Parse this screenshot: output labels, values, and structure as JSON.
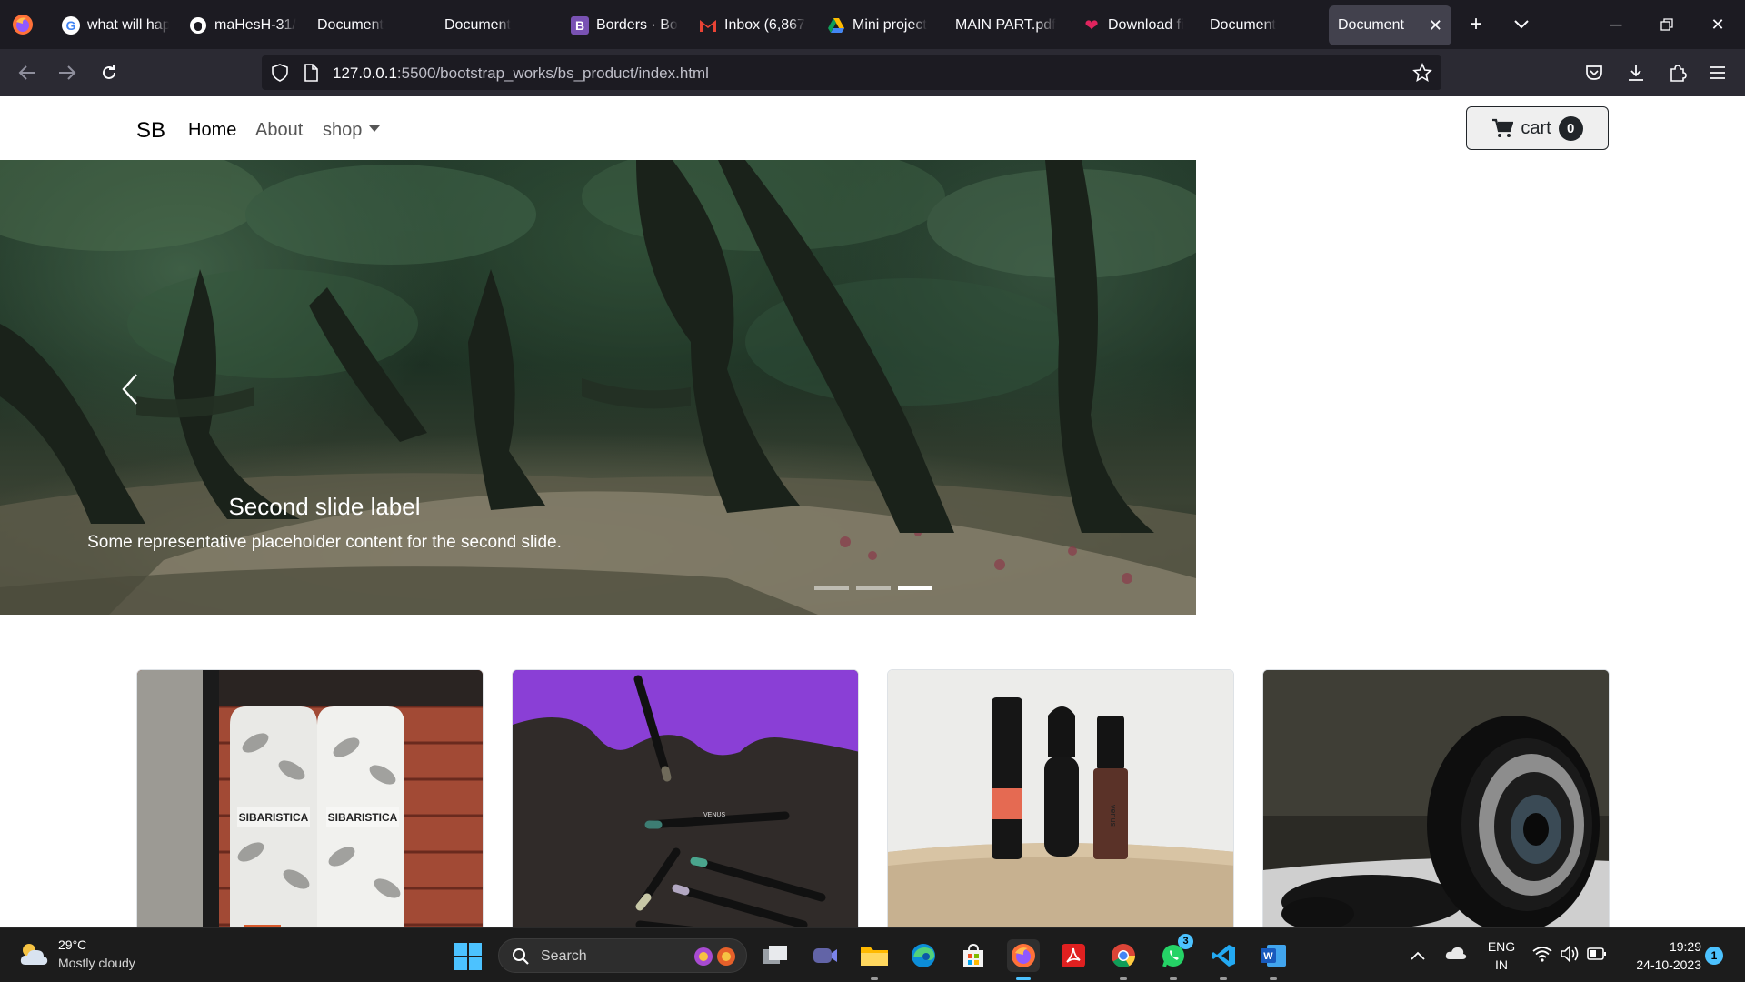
{
  "browser": {
    "tabs": [
      {
        "label": "what will hap",
        "icon": "google-icon",
        "active": false
      },
      {
        "label": "maHesH-31/",
        "icon": "github-icon",
        "active": false
      },
      {
        "label": "Document",
        "icon": "none",
        "active": false
      },
      {
        "label": "Document",
        "icon": "none",
        "active": false
      },
      {
        "label": "Borders · Boo",
        "icon": "bootstrap-icon",
        "active": false
      },
      {
        "label": "Inbox (6,867",
        "icon": "gmail-icon",
        "active": false
      },
      {
        "label": "Mini project",
        "icon": "drive-icon",
        "active": false
      },
      {
        "label": "MAIN PART.pdf",
        "icon": "none",
        "active": false
      },
      {
        "label": "Download fi",
        "icon": "heart-icon",
        "active": false
      },
      {
        "label": "Document",
        "icon": "none",
        "active": false
      },
      {
        "label": "Document",
        "icon": "none",
        "active": true
      }
    ],
    "url_host": "127.0.0.1",
    "url_path": ":5500/bootstrap_works/bs_product/index.html"
  },
  "site": {
    "brand": "SB",
    "nav": {
      "home": "Home",
      "about": "About",
      "shop": "shop"
    },
    "cart": {
      "label": "cart",
      "count": "0"
    }
  },
  "carousel": {
    "title": "Second slide label",
    "text": "Some representative placeholder content for the second slide.",
    "slide_count": 3,
    "active_index": 2
  },
  "products": [
    {
      "name": "coffee-bags",
      "bag_text": "SIBARISTICA"
    },
    {
      "name": "eyeliner-pencils",
      "brand_text": "VENUS"
    },
    {
      "name": "cosmetics-bottles",
      "brand_text": "venus"
    },
    {
      "name": "camera-lens"
    }
  ],
  "taskbar": {
    "weather_temp": "29°C",
    "weather_desc": "Mostly cloudy",
    "search_label": "Search",
    "lang_top": "ENG",
    "lang_bottom": "IN",
    "time": "19:29",
    "date": "24-10-2023",
    "notification_count": "1",
    "whatsapp_badge": "3"
  },
  "colors": {
    "tabbar_bg": "#1c1b22",
    "toolbar_bg": "#2b2a33",
    "taskbar_bg": "#1c1c1c",
    "accent": "#4cc2ff"
  }
}
